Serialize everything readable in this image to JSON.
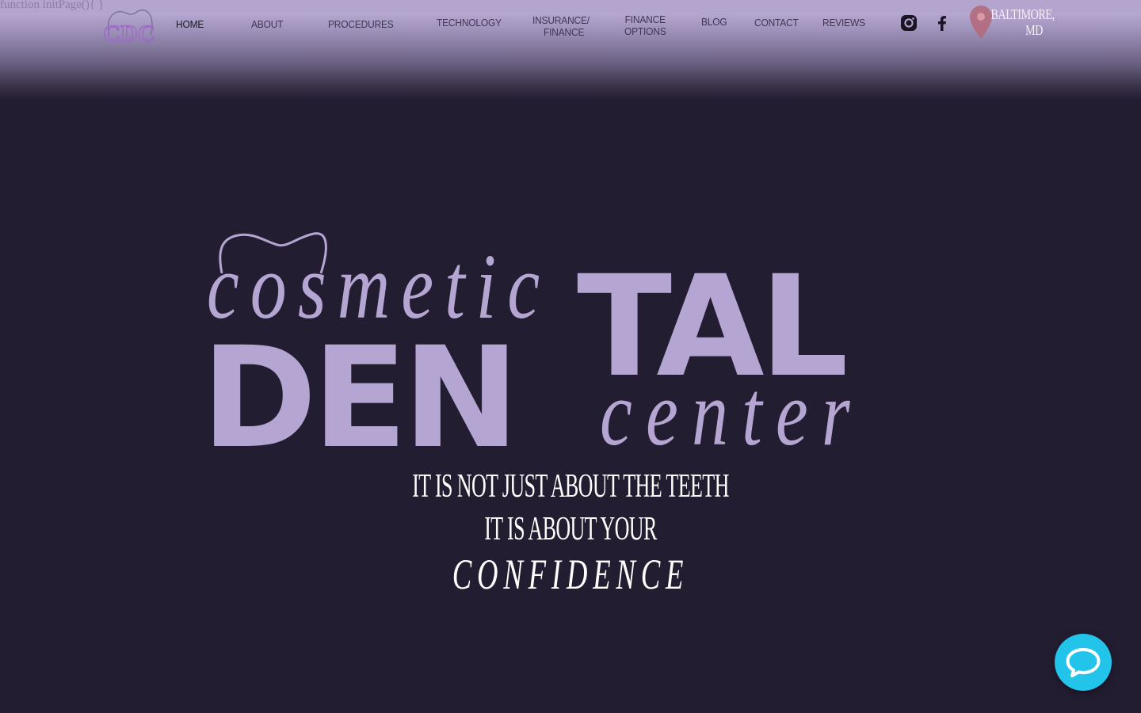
{
  "top_code": "function initPage(){ }",
  "brand": {
    "logo_icon": "tooth-logo-icon",
    "word_cosmetic": "cosmetic",
    "word_den": "DEN",
    "word_tal": "TAL",
    "word_center": "center",
    "color": "#b4a5d2"
  },
  "nav": {
    "items": [
      {
        "lines": [
          "HOME"
        ],
        "active": true
      },
      {
        "lines": [
          "ABOUT"
        ]
      },
      {
        "lines": [
          "PROCEDURES"
        ]
      },
      {
        "lines": [
          "TECHNOLOGY"
        ]
      },
      {
        "lines": [
          "INSURANCE/",
          "FINANCE"
        ]
      },
      {
        "lines": [
          "FINANCE",
          "OPTIONS"
        ]
      },
      {
        "lines": [
          "BLOG"
        ]
      },
      {
        "lines": [
          "CONTACT"
        ]
      },
      {
        "lines": [
          "REVIEWS"
        ]
      }
    ]
  },
  "social": {
    "instagram_icon": "instagram-icon",
    "facebook_icon": "facebook-icon"
  },
  "location": {
    "icon": "map-pin-icon",
    "line1": "BALTIMORE,",
    "line2": "MD"
  },
  "hero": {
    "line1": "IT IS NOT JUST ABOUT THE TEETH",
    "line2": "IT IS ABOUT YOUR",
    "line3": "CONFIDENCE"
  },
  "chat": {
    "icon": "chat-bubble-icon",
    "color": "#22c4ea"
  }
}
